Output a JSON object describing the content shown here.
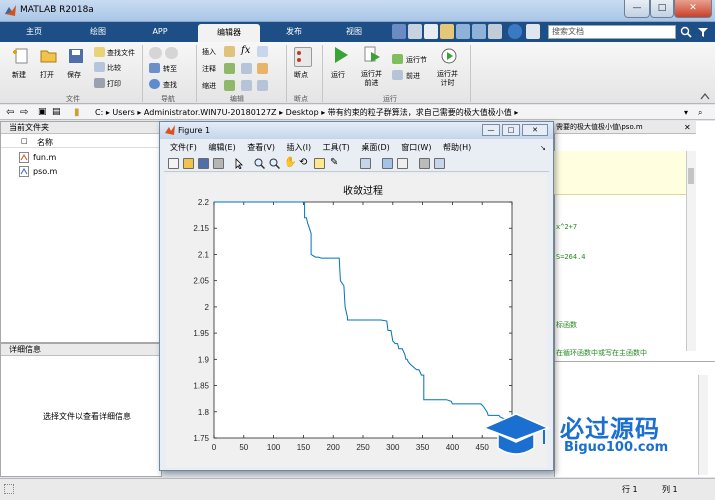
{
  "window": {
    "title": "MATLAB R2018a"
  },
  "ribbon_tabs": [
    "主页",
    "绘图",
    "APP",
    "编辑器",
    "发布",
    "视图"
  ],
  "active_tab": "编辑器",
  "search": {
    "placeholder": "搜索文档"
  },
  "ribbon": {
    "groups": [
      "文件",
      "导航",
      "编辑",
      "断点",
      "运行"
    ],
    "file": {
      "new": "新建",
      "open": "打开",
      "save": "保存",
      "find_files": "查找文件",
      "compare": "比较",
      "print": "打印"
    },
    "nav": {
      "goto": "转至",
      "find": "查找"
    },
    "edit": {
      "insert": "插入",
      "comment": "注释",
      "indent": "缩进",
      "fx": "fx"
    },
    "breakpoints": {
      "bp": "断点"
    },
    "run": {
      "run": "运行",
      "run_advance": "运行并\n前进",
      "run_section": "运行节",
      "advance": "前进",
      "run_time": "运行并\n计时"
    }
  },
  "address": [
    "C:",
    "Users",
    "Administrator.WIN7U-20180127Z",
    "Desktop",
    "带有约束的粒子群算法，求自己需要的极大值极小值"
  ],
  "current_folder": {
    "title": "当前文件夹",
    "col_name": "名称",
    "files": [
      "fun.m",
      "pso.m"
    ]
  },
  "details": {
    "title": "详细信息",
    "hint": "选择文件以查看详细信息"
  },
  "editor_tab": {
    "title": "需要的极大值极小值\\pso.m"
  },
  "code_fragments": [
    "x^2+7",
    "S=264.4",
    "标函数",
    "在循环函数中或写在主函数中"
  ],
  "figure": {
    "title": "Figure 1",
    "menu": [
      "文件(F)",
      "编辑(E)",
      "查看(V)",
      "插入(I)",
      "工具(T)",
      "桌面(D)",
      "窗口(W)",
      "帮助(H)"
    ]
  },
  "chart_data": {
    "type": "line",
    "title": "收敛过程",
    "xlabel": "",
    "ylabel": "",
    "xlim": [
      0,
      500
    ],
    "ylim": [
      1.75,
      2.2
    ],
    "xticks": [
      0,
      50,
      100,
      150,
      200,
      250,
      300,
      350,
      400,
      450,
      500
    ],
    "yticks": [
      1.75,
      1.8,
      1.85,
      1.9,
      1.95,
      2.0,
      2.05,
      2.1,
      2.15,
      2.2
    ],
    "grid": false,
    "series": [
      {
        "x": [
          0,
          148,
          152,
          152,
          155,
          157,
          160,
          163,
          163,
          170,
          175,
          180,
          200,
          210,
          212,
          218,
          220,
          224,
          224,
          240,
          250,
          260,
          270,
          280,
          290,
          292,
          297,
          300,
          304,
          308,
          310,
          316,
          318,
          320,
          322,
          324,
          326,
          330,
          340,
          344,
          348,
          352,
          352,
          360,
          370,
          380,
          390,
          398,
          400,
          410,
          420,
          430,
          440,
          448,
          452,
          458,
          460,
          470,
          478,
          480,
          490,
          500
        ],
        "y": [
          2.2,
          2.2,
          2.2,
          2.17,
          2.17,
          2.16,
          2.15,
          2.14,
          2.1,
          2.095,
          2.095,
          2.093,
          2.093,
          2.093,
          2.05,
          2.04,
          2.0,
          1.98,
          1.975,
          1.975,
          1.975,
          1.975,
          1.975,
          1.975,
          1.973,
          1.955,
          1.955,
          1.935,
          1.93,
          1.93,
          1.92,
          1.92,
          1.915,
          1.91,
          1.9,
          1.9,
          1.895,
          1.89,
          1.88,
          1.88,
          1.87,
          1.87,
          1.823,
          1.823,
          1.823,
          1.823,
          1.823,
          1.82,
          1.815,
          1.815,
          1.815,
          1.815,
          1.815,
          1.815,
          1.81,
          1.8,
          1.793,
          1.793,
          1.793,
          1.79,
          1.785,
          1.785
        ]
      }
    ]
  },
  "statusbar": {
    "line": "行 1",
    "col": "列 1"
  },
  "watermark": {
    "brand": "必过源码",
    "url": "Biguo100.com"
  },
  "colors": {
    "ribbon_tab_bg": "#1d4f86",
    "line": "#0072bd",
    "watermark": "#1a6fd0"
  }
}
